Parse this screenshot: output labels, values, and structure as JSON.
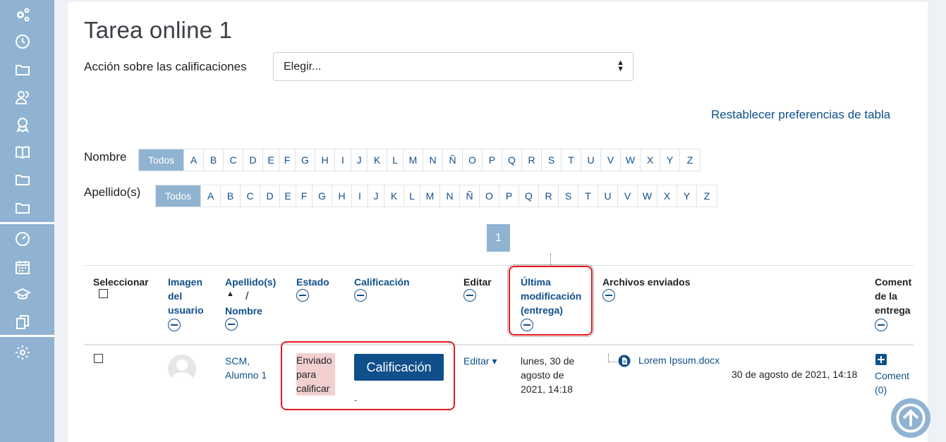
{
  "sidebar": {
    "icons": [
      "gears-icon",
      "clock-icon",
      "folder-icon",
      "users-icon",
      "award-icon",
      "book-icon",
      "folder-icon",
      "folder-icon",
      "dashboard-icon",
      "calendar-icon",
      "graduation-cap-icon",
      "copy-icon",
      "gear-icon"
    ]
  },
  "page": {
    "title": "Tarea online 1",
    "action_label": "Acción sobre las calificaciones",
    "action_select": "Elegir...",
    "reset_link": "Restablecer preferencias de tabla"
  },
  "initials": {
    "first_label": "Nombre",
    "last_label": "Apellido(s)",
    "all_label": "Todos",
    "letters": [
      "A",
      "B",
      "C",
      "D",
      "E",
      "F",
      "G",
      "H",
      "I",
      "J",
      "K",
      "L",
      "M",
      "N",
      "Ñ",
      "O",
      "P",
      "Q",
      "R",
      "S",
      "T",
      "U",
      "V",
      "W",
      "X",
      "Y",
      "Z"
    ]
  },
  "pagination": {
    "current": "1"
  },
  "table": {
    "headers": {
      "select": "Seleccionar",
      "image_l1": "Imagen",
      "image_l2": "del",
      "image_l3": "usuario",
      "lastname": "Apellido(s)",
      "sort_arrow": "▲",
      "slash": "/",
      "firstname": "Nombre",
      "status": "Estado",
      "grade": "Calificación",
      "edit": "Editar",
      "lastmod_l1": "Última",
      "lastmod_l2": "modificación",
      "lastmod_l3": "(entrega)",
      "files": "Archivos enviados",
      "comment_l1": "Coment",
      "comment_l2": "de la",
      "comment_l3": "entrega"
    },
    "row": {
      "name_l1": "SCM,",
      "name_l2": "Alumno 1",
      "status_l1": "Enviado",
      "status_l2": "para",
      "status_l3": "calificar",
      "grade_button": "Calificación",
      "grade_value": "-",
      "edit_label": "Editar ▾",
      "lastmod_l1": "lunes, 30 de",
      "lastmod_l2": "agosto de",
      "lastmod_l3": "2021, 14:18",
      "file_name": "Lorem Ipsum.docx",
      "file_date": "30 de agosto de 2021, 14:18",
      "comment_l1": "Coment",
      "comment_l2": "(0)"
    }
  },
  "colors": {
    "accent": "#0f4f8a",
    "sidebar": "#8fb3d1",
    "highlight": "#e4181c",
    "status_bg": "#f3d0d0"
  }
}
